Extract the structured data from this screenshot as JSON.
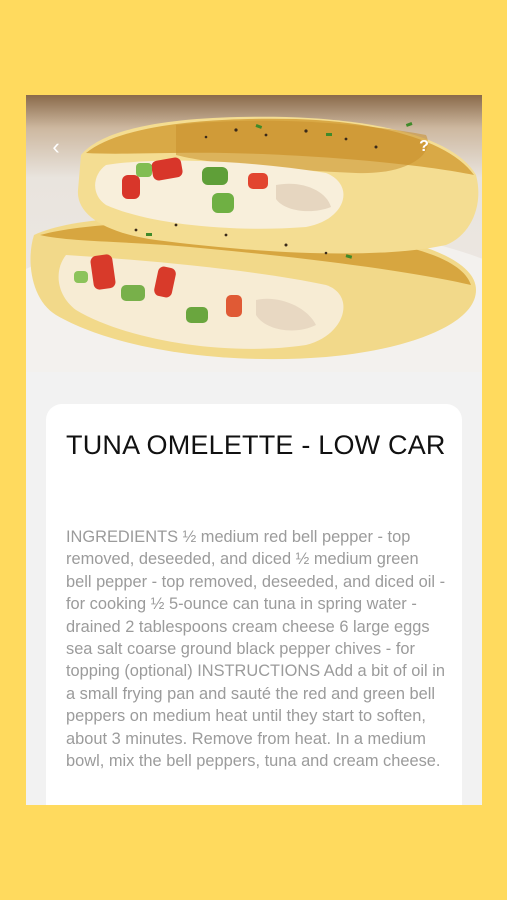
{
  "recipe": {
    "title": "TUNA OMELETTE - LOW CAR",
    "description": "INGREDIENTS ½ medium red bell pepper - top removed, deseeded, and diced ½ medium green bell pepper - top removed, deseeded, and diced oil - for cooking ½ 5-ounce can tuna in spring water - drained 2 tablespoons cream cheese 6 large eggs sea salt coarse ground black pepper chives - for topping (optional) INSTRUCTIONS Add a bit of oil in a small frying pan and sauté the red and green bell peppers on medium heat until they start to soften, about 3 minutes. Remove from heat. In a medium bowl, mix the bell peppers, tuna and cream cheese."
  },
  "nav": {
    "back_icon": "‹",
    "help_icon": "?"
  },
  "colors": {
    "background": "#FFDA5E",
    "card": "#FFFFFF",
    "title": "#111111",
    "body": "#9B9B9B"
  }
}
